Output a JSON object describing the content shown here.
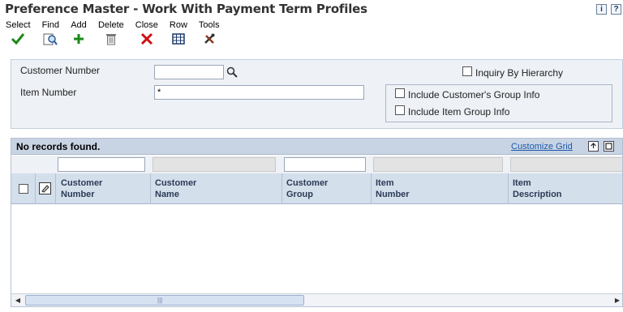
{
  "window": {
    "title": "Preference Master - Work With Payment Term Profiles",
    "info_icon": "i",
    "help_icon": "?"
  },
  "toolbar": {
    "items": [
      {
        "label": "Select",
        "icon": "checkmark-icon",
        "color": "#1a8a1a"
      },
      {
        "label": "Find",
        "icon": "find-icon",
        "color": "#3b6fb5"
      },
      {
        "label": "Add",
        "icon": "plus-icon",
        "color": "#1a8a1a"
      },
      {
        "label": "Delete",
        "icon": "trash-icon",
        "color": "#666666"
      },
      {
        "label": "Close",
        "icon": "x-icon",
        "color": "#cc1111"
      },
      {
        "label": "Row",
        "icon": "grid-icon",
        "color": "#1d3a6c"
      },
      {
        "label": "Tools",
        "icon": "tools-icon",
        "color": "#333333"
      }
    ]
  },
  "criteria": {
    "customer_number_label": "Customer Number",
    "customer_number_value": "",
    "item_number_label": "Item Number",
    "item_number_value": "*",
    "inquiry_by_hierarchy": "Inquiry By Hierarchy",
    "include_customer_group": "Include Customer's Group Info",
    "include_item_group": "Include Item Group Info"
  },
  "grid": {
    "message": "No records found.",
    "customize_link": "Customize Grid",
    "columns": [
      {
        "line1": "Customer",
        "line2": "Number"
      },
      {
        "line1": "Customer",
        "line2": "Name"
      },
      {
        "line1": "Customer",
        "line2": "Group"
      },
      {
        "line1": "Item",
        "line2": "Number"
      },
      {
        "line1": "Item",
        "line2": "Description"
      }
    ],
    "scroll_grip": "|||"
  }
}
